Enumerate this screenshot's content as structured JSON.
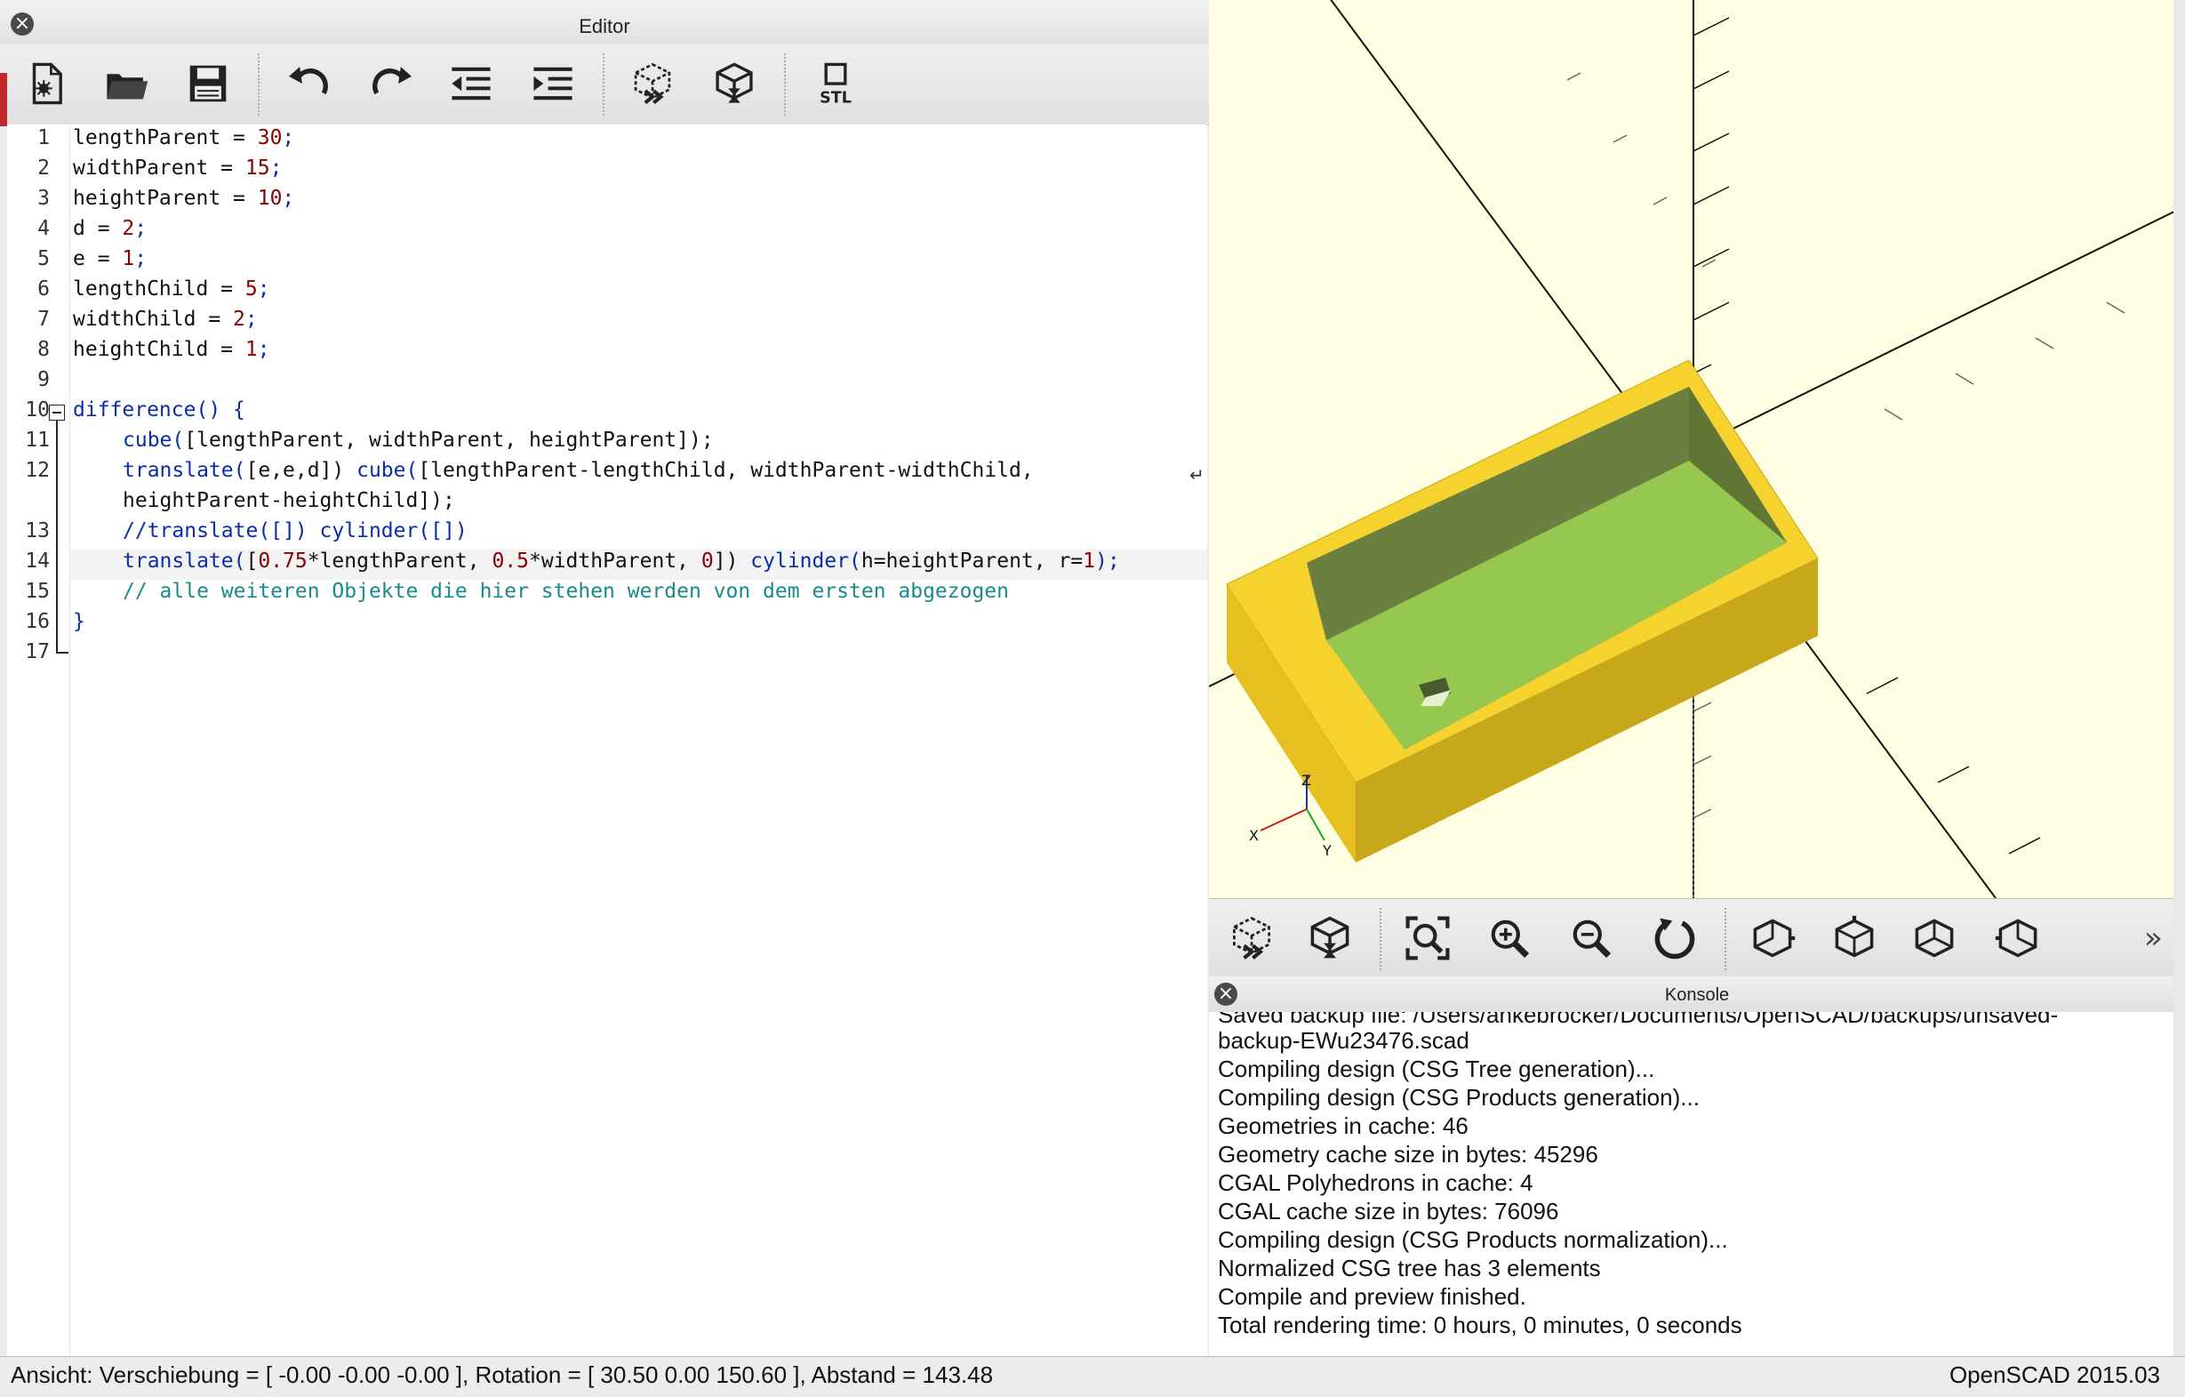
{
  "editor": {
    "title": "Editor",
    "toolbar_icons": [
      "new-file-icon",
      "open-file-icon",
      "save-icon",
      "undo-icon",
      "redo-icon",
      "unindent-icon",
      "indent-icon",
      "preview-icon",
      "render-icon",
      "export-stl-icon"
    ],
    "stl_label": "STL",
    "line_numbers": [
      "1",
      "2",
      "3",
      "4",
      "5",
      "6",
      "7",
      "8",
      "9",
      "10",
      "11",
      "12",
      "13",
      "14",
      "15",
      "16",
      "17"
    ],
    "code": {
      "l1": {
        "a": "lengthParent = ",
        "n": "30",
        ";": ";"
      },
      "l2": {
        "a": "widthParent = ",
        "n": "15",
        ";": ";"
      },
      "l3": {
        "a": "heightParent = ",
        "n": "10",
        ";": ";"
      },
      "l4": {
        "a": "d = ",
        "n": "2",
        ";": ";"
      },
      "l5": {
        "a": "e = ",
        "n": "1",
        ";": ";"
      },
      "l6": {
        "a": "lengthChild = ",
        "n": "5",
        ";": ";"
      },
      "l7": {
        "a": "widthChild = ",
        "n": "2",
        ";": ";"
      },
      "l8": {
        "a": "heightChild = ",
        "n": "1",
        ";": ";"
      },
      "l10": "difference() {",
      "l11_kw": "cube(",
      "l11_rest": "[lengthParent, widthParent, heightParent]);",
      "l12_kw1": "translate(",
      "l12_mid": "[e,e,d]) ",
      "l12_kw2": "cube(",
      "l12_rest": "[lengthParent-lengthChild, widthParent-widthChild,",
      "l12b": "heightParent-heightChild]);",
      "l13": "//translate([]) cylinder([])",
      "l14_kw1": "translate(",
      "l14_p1": "[",
      "l14_n1": "0.75",
      "l14_p2": "*lengthParent, ",
      "l14_n2": "0.5",
      "l14_p3": "*widthParent, ",
      "l14_n3": "0",
      "l14_p4": "]) ",
      "l14_kw2": "cylinder(",
      "l14_p5": "h=heightParent, r=",
      "l14_n4": "1",
      "l14_p6": ");",
      "l15": "// alle weiteren Objekte die hier stehen werden von dem ersten abgezogen",
      "l16": "}"
    }
  },
  "viewport": {
    "axis_labels": {
      "z": "Z",
      "x": "X",
      "y": "Y"
    },
    "colors": {
      "background": "#fefee2",
      "object_outer": "#f5d130",
      "object_inner": "#96c850"
    }
  },
  "view_toolbar": {
    "icons": [
      "preview-icon",
      "render-icon",
      "view-all-icon",
      "zoom-in-icon",
      "zoom-out-icon",
      "reset-view-icon",
      "view-right-icon",
      "view-top-icon",
      "view-bottom-icon",
      "view-left-icon",
      "more-icon"
    ],
    "more_label": "»"
  },
  "console": {
    "title": "Konsole",
    "lines": [
      "Saved backup file: /Users/ankebrocker/Documents/OpenSCAD/backups/unsaved-",
      "backup-EWu23476.scad",
      "Compiling design (CSG Tree generation)...",
      "Compiling design (CSG Products generation)...",
      "Geometries in cache: 46",
      "Geometry cache size in bytes: 45296",
      "CGAL Polyhedrons in cache: 4",
      "CGAL cache size in bytes: 76096",
      "Compiling design (CSG Products normalization)...",
      "Normalized CSG tree has 3 elements",
      "Compile and preview finished.",
      "Total rendering time: 0 hours, 0 minutes, 0 seconds"
    ]
  },
  "statusbar": {
    "view_info": "Ansicht: Verschiebung = [ -0.00 -0.00 -0.00 ], Rotation = [ 30.50 0.00 150.60 ], Abstand = 143.48",
    "version": "OpenSCAD 2015.03"
  }
}
